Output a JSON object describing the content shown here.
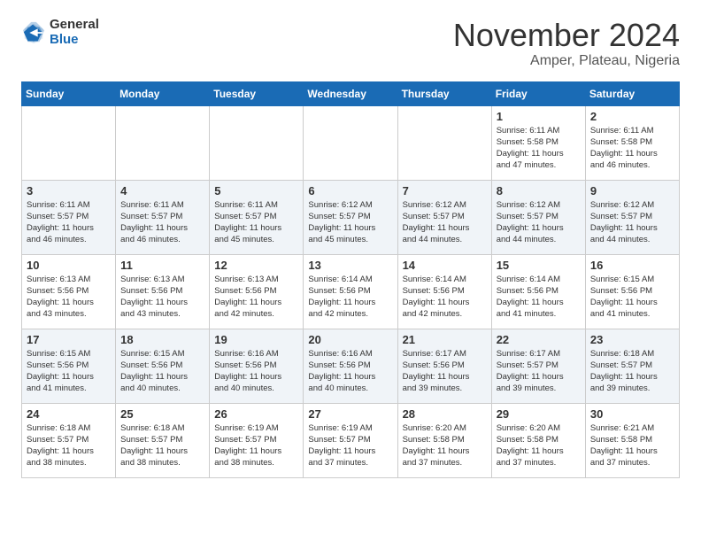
{
  "header": {
    "logo": {
      "general": "General",
      "blue": "Blue"
    },
    "title": "November 2024",
    "subtitle": "Amper, Plateau, Nigeria"
  },
  "days_of_week": [
    "Sunday",
    "Monday",
    "Tuesday",
    "Wednesday",
    "Thursday",
    "Friday",
    "Saturday"
  ],
  "weeks": [
    [
      {
        "day": "",
        "info": ""
      },
      {
        "day": "",
        "info": ""
      },
      {
        "day": "",
        "info": ""
      },
      {
        "day": "",
        "info": ""
      },
      {
        "day": "",
        "info": ""
      },
      {
        "day": "1",
        "info": "Sunrise: 6:11 AM\nSunset: 5:58 PM\nDaylight: 11 hours\nand 47 minutes."
      },
      {
        "day": "2",
        "info": "Sunrise: 6:11 AM\nSunset: 5:58 PM\nDaylight: 11 hours\nand 46 minutes."
      }
    ],
    [
      {
        "day": "3",
        "info": "Sunrise: 6:11 AM\nSunset: 5:57 PM\nDaylight: 11 hours\nand 46 minutes."
      },
      {
        "day": "4",
        "info": "Sunrise: 6:11 AM\nSunset: 5:57 PM\nDaylight: 11 hours\nand 46 minutes."
      },
      {
        "day": "5",
        "info": "Sunrise: 6:11 AM\nSunset: 5:57 PM\nDaylight: 11 hours\nand 45 minutes."
      },
      {
        "day": "6",
        "info": "Sunrise: 6:12 AM\nSunset: 5:57 PM\nDaylight: 11 hours\nand 45 minutes."
      },
      {
        "day": "7",
        "info": "Sunrise: 6:12 AM\nSunset: 5:57 PM\nDaylight: 11 hours\nand 44 minutes."
      },
      {
        "day": "8",
        "info": "Sunrise: 6:12 AM\nSunset: 5:57 PM\nDaylight: 11 hours\nand 44 minutes."
      },
      {
        "day": "9",
        "info": "Sunrise: 6:12 AM\nSunset: 5:57 PM\nDaylight: 11 hours\nand 44 minutes."
      }
    ],
    [
      {
        "day": "10",
        "info": "Sunrise: 6:13 AM\nSunset: 5:56 PM\nDaylight: 11 hours\nand 43 minutes."
      },
      {
        "day": "11",
        "info": "Sunrise: 6:13 AM\nSunset: 5:56 PM\nDaylight: 11 hours\nand 43 minutes."
      },
      {
        "day": "12",
        "info": "Sunrise: 6:13 AM\nSunset: 5:56 PM\nDaylight: 11 hours\nand 42 minutes."
      },
      {
        "day": "13",
        "info": "Sunrise: 6:14 AM\nSunset: 5:56 PM\nDaylight: 11 hours\nand 42 minutes."
      },
      {
        "day": "14",
        "info": "Sunrise: 6:14 AM\nSunset: 5:56 PM\nDaylight: 11 hours\nand 42 minutes."
      },
      {
        "day": "15",
        "info": "Sunrise: 6:14 AM\nSunset: 5:56 PM\nDaylight: 11 hours\nand 41 minutes."
      },
      {
        "day": "16",
        "info": "Sunrise: 6:15 AM\nSunset: 5:56 PM\nDaylight: 11 hours\nand 41 minutes."
      }
    ],
    [
      {
        "day": "17",
        "info": "Sunrise: 6:15 AM\nSunset: 5:56 PM\nDaylight: 11 hours\nand 41 minutes."
      },
      {
        "day": "18",
        "info": "Sunrise: 6:15 AM\nSunset: 5:56 PM\nDaylight: 11 hours\nand 40 minutes."
      },
      {
        "day": "19",
        "info": "Sunrise: 6:16 AM\nSunset: 5:56 PM\nDaylight: 11 hours\nand 40 minutes."
      },
      {
        "day": "20",
        "info": "Sunrise: 6:16 AM\nSunset: 5:56 PM\nDaylight: 11 hours\nand 40 minutes."
      },
      {
        "day": "21",
        "info": "Sunrise: 6:17 AM\nSunset: 5:56 PM\nDaylight: 11 hours\nand 39 minutes."
      },
      {
        "day": "22",
        "info": "Sunrise: 6:17 AM\nSunset: 5:57 PM\nDaylight: 11 hours\nand 39 minutes."
      },
      {
        "day": "23",
        "info": "Sunrise: 6:18 AM\nSunset: 5:57 PM\nDaylight: 11 hours\nand 39 minutes."
      }
    ],
    [
      {
        "day": "24",
        "info": "Sunrise: 6:18 AM\nSunset: 5:57 PM\nDaylight: 11 hours\nand 38 minutes."
      },
      {
        "day": "25",
        "info": "Sunrise: 6:18 AM\nSunset: 5:57 PM\nDaylight: 11 hours\nand 38 minutes."
      },
      {
        "day": "26",
        "info": "Sunrise: 6:19 AM\nSunset: 5:57 PM\nDaylight: 11 hours\nand 38 minutes."
      },
      {
        "day": "27",
        "info": "Sunrise: 6:19 AM\nSunset: 5:57 PM\nDaylight: 11 hours\nand 37 minutes."
      },
      {
        "day": "28",
        "info": "Sunrise: 6:20 AM\nSunset: 5:58 PM\nDaylight: 11 hours\nand 37 minutes."
      },
      {
        "day": "29",
        "info": "Sunrise: 6:20 AM\nSunset: 5:58 PM\nDaylight: 11 hours\nand 37 minutes."
      },
      {
        "day": "30",
        "info": "Sunrise: 6:21 AM\nSunset: 5:58 PM\nDaylight: 11 hours\nand 37 minutes."
      }
    ]
  ]
}
